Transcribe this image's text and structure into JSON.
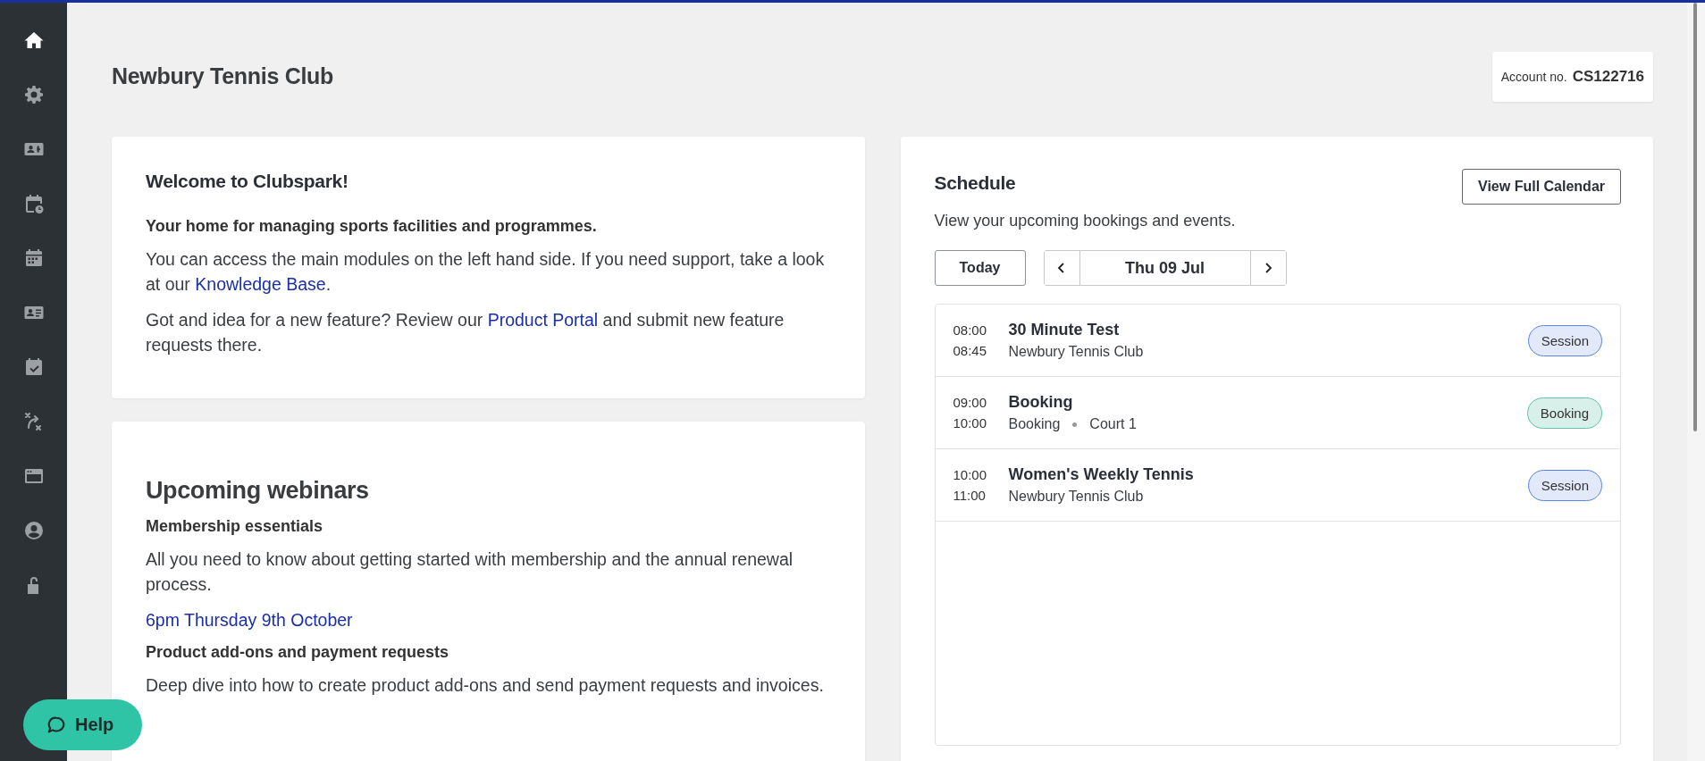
{
  "sidebar": {
    "items": [
      {
        "selected": true
      },
      {
        "selected": false
      },
      {
        "selected": false
      },
      {
        "selected": false
      },
      {
        "selected": false
      },
      {
        "selected": false
      },
      {
        "selected": false
      },
      {
        "selected": false
      },
      {
        "selected": false
      },
      {
        "selected": false
      },
      {
        "selected": false
      }
    ]
  },
  "page_title": "Newbury Tennis Club",
  "account": {
    "label": "Account no.",
    "number": "CS122716"
  },
  "welcome": {
    "title": "Welcome to Clubspark!",
    "lead": "Your home for managing sports facilities and programmes.",
    "paragraphs": [
      [
        {
          "kind": "text",
          "text": "You can access the main modules on the left hand side. If you need support, take a look at our "
        },
        {
          "kind": "link",
          "text": "Knowledge Base"
        },
        {
          "kind": "text",
          "text": "."
        }
      ],
      [
        {
          "kind": "text",
          "text": "Got and idea for a new feature? Review our "
        },
        {
          "kind": "link",
          "text": "Product Portal"
        },
        {
          "kind": "text",
          "text": " and submit new feature requests there."
        }
      ]
    ]
  },
  "webinars": {
    "title": "Upcoming webinars",
    "items": [
      {
        "title": "Membership essentials",
        "description": "All you need to know about getting started with membership and the annual renewal process.",
        "when": "6pm Thursday 9th October"
      },
      {
        "title": "Product add-ons and payment requests",
        "description": "Deep dive into how to create product add-ons and send payment requests and invoices."
      }
    ]
  },
  "schedule": {
    "title": "Schedule",
    "button": "View Full Calendar",
    "subtitle": "View your upcoming bookings and events.",
    "today": "Today",
    "date": "Thu 09 Jul",
    "events": [
      {
        "start": "08:00",
        "end": "08:45",
        "title": "30 Minute Test",
        "details": [
          "Newbury Tennis Club"
        ],
        "tag": "Session",
        "kind": "session"
      },
      {
        "start": "09:00",
        "end": "10:00",
        "title": "Booking",
        "details": [
          "Booking",
          "Court 1"
        ],
        "tag": "Booking",
        "kind": "booking"
      },
      {
        "start": "10:00",
        "end": "11:00",
        "title": "Women's Weekly Tennis",
        "details": [
          "Newbury Tennis Club"
        ],
        "tag": "Session",
        "kind": "session"
      }
    ]
  },
  "help": {
    "label": "Help"
  }
}
